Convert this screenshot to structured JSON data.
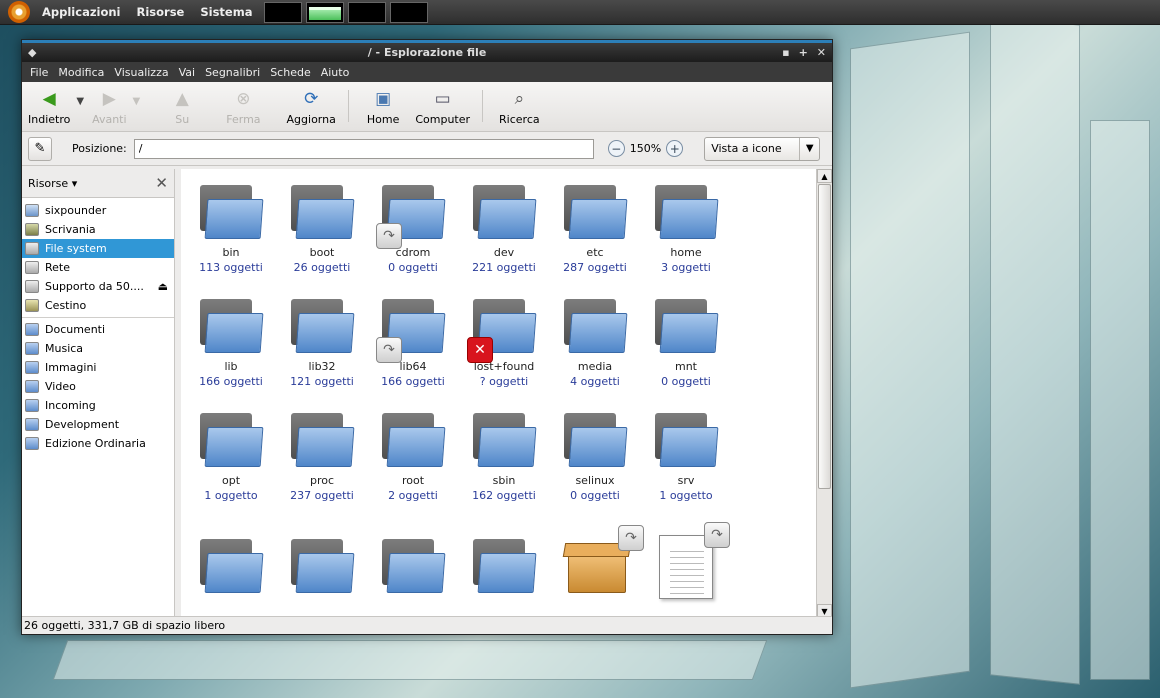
{
  "panel": {
    "menus": [
      "Applicazioni",
      "Risorse",
      "Sistema"
    ],
    "logo_icon": "ubuntu-logo-icon"
  },
  "window": {
    "title": "/ - Esplorazione file",
    "menu": [
      "File",
      "Modifica",
      "Visualizza",
      "Vai",
      "Segnalibri",
      "Schede",
      "Aiuto"
    ],
    "toolbar": {
      "back": "Indietro",
      "forward": "Avanti",
      "up": "Su",
      "stop": "Ferma",
      "reload": "Aggiorna",
      "home": "Home",
      "computer": "Computer",
      "search": "Ricerca"
    },
    "location": {
      "label": "Posizione:",
      "value": "/",
      "zoom": "150%",
      "view_mode": "Vista a icone"
    },
    "sidebar": {
      "header": "Risorse",
      "places": [
        {
          "label": "sixpounder",
          "icon": "home-folder-icon"
        },
        {
          "label": "Scrivania",
          "icon": "desktop-icon"
        },
        {
          "label": "File system",
          "icon": "harddisk-icon",
          "selected": true
        },
        {
          "label": "Rete",
          "icon": "network-icon"
        },
        {
          "label": "Supporto da 50....",
          "icon": "drive-icon",
          "eject": true
        },
        {
          "label": "Cestino",
          "icon": "trash-icon"
        }
      ],
      "bookmarks": [
        "Documenti",
        "Musica",
        "Immagini",
        "Video",
        "Incoming",
        "Development",
        "Edizione Ordinaria"
      ]
    },
    "files": [
      {
        "name": "bin",
        "count": "113 oggetti"
      },
      {
        "name": "boot",
        "count": "26 oggetti"
      },
      {
        "name": "cdrom",
        "count": "0 oggetti",
        "emblem": "link"
      },
      {
        "name": "dev",
        "count": "221 oggetti"
      },
      {
        "name": "etc",
        "count": "287 oggetti"
      },
      {
        "name": "home",
        "count": "3 oggetti"
      },
      {
        "name": "lib",
        "count": "166 oggetti"
      },
      {
        "name": "lib32",
        "count": "121 oggetti"
      },
      {
        "name": "lib64",
        "count": "166 oggetti",
        "emblem": "link"
      },
      {
        "name": "lost+found",
        "count": "? oggetti",
        "emblem": "error"
      },
      {
        "name": "media",
        "count": "4 oggetti"
      },
      {
        "name": "mnt",
        "count": "0 oggetti"
      },
      {
        "name": "opt",
        "count": "1 oggetto"
      },
      {
        "name": "proc",
        "count": "237 oggetti"
      },
      {
        "name": "root",
        "count": "2 oggetti"
      },
      {
        "name": "sbin",
        "count": "162 oggetti"
      },
      {
        "name": "selinux",
        "count": "0 oggetti"
      },
      {
        "name": "srv",
        "count": "1 oggetto"
      },
      {
        "name": "",
        "count": "",
        "kind": "folder"
      },
      {
        "name": "",
        "count": "",
        "kind": "folder"
      },
      {
        "name": "",
        "count": "",
        "kind": "folder"
      },
      {
        "name": "",
        "count": "",
        "kind": "folder"
      },
      {
        "name": "",
        "count": "",
        "kind": "package",
        "emblem": "link"
      },
      {
        "name": "",
        "count": "",
        "kind": "document",
        "emblem": "link"
      }
    ],
    "status": "26 oggetti, 331,7 GB di spazio libero"
  }
}
